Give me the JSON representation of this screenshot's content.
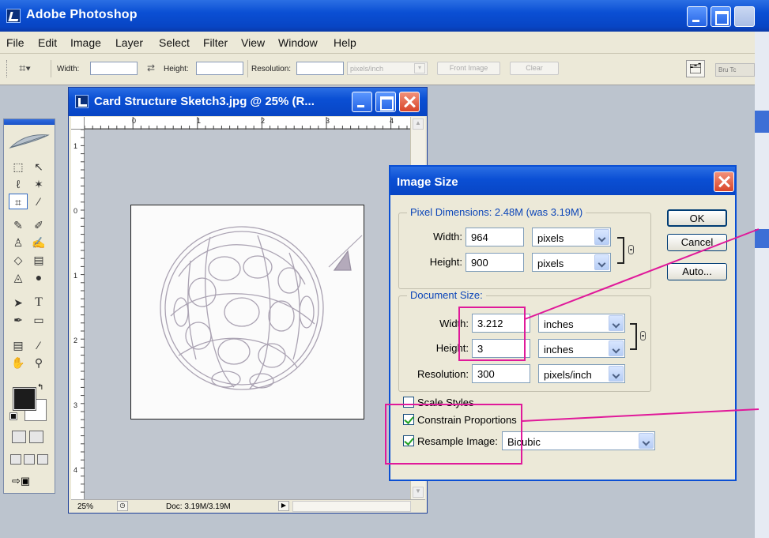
{
  "app": {
    "title": "Adobe Photoshop"
  },
  "menu": {
    "items": [
      "File",
      "Edit",
      "Image",
      "Layer",
      "Select",
      "Filter",
      "View",
      "Window",
      "Help"
    ]
  },
  "options_bar": {
    "width_label": "Width:",
    "height_label": "Height:",
    "resolution_label": "Resolution:",
    "units_value": "pixels/inch",
    "front_image_label": "Front Image",
    "clear_label": "Clear",
    "palette_tabs": "Bru Tc"
  },
  "document": {
    "title": "Card Structure Sketch3.jpg @ 25% (R...",
    "ruler_h_labels": [
      "0",
      "1",
      "2",
      "3",
      "4"
    ],
    "ruler_v_labels": [
      "1",
      "0",
      "1",
      "2",
      "3",
      "4"
    ],
    "zoom": "25%",
    "doc_info": "Doc: 3.19M/3.19M"
  },
  "dialog": {
    "title": "Image Size",
    "pixel_dimensions": {
      "legend": "Pixel Dimensions: 2.48M (was 3.19M)",
      "width_label": "Width:",
      "width_value": "964",
      "width_unit": "pixels",
      "height_label": "Height:",
      "height_value": "900",
      "height_unit": "pixels"
    },
    "document_size": {
      "legend": "Document Size:",
      "width_label": "Width:",
      "width_value": "3.212",
      "width_unit": "inches",
      "height_label": "Height:",
      "height_value": "3",
      "height_unit": "inches",
      "resolution_label": "Resolution:",
      "resolution_value": "300",
      "resolution_unit": "pixels/inch"
    },
    "scale_styles": {
      "label": "Scale Styles",
      "checked": false
    },
    "constrain_proportions": {
      "label": "Constrain Proportions",
      "checked": true
    },
    "resample_image": {
      "label": "Resample Image:",
      "checked": true,
      "method": "Bicubic"
    },
    "buttons": {
      "ok": "OK",
      "cancel": "Cancel",
      "auto": "Auto..."
    }
  },
  "colors": {
    "titlebar_blue": "#0a4fd4",
    "annotation": "#e0199a",
    "dialog_bg": "#ece9d8",
    "legend_blue": "#0b45b8"
  }
}
